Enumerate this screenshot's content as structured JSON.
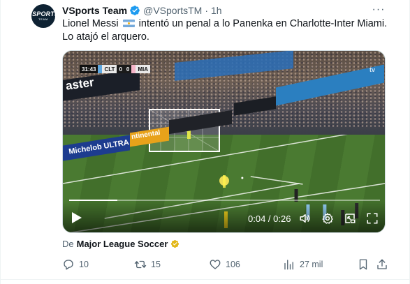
{
  "tweet": {
    "author_name": "VSports Team",
    "handle": "@VSportsTM",
    "separator": "·",
    "time": "1h",
    "avatar_text": "VSPORTS",
    "avatar_subtext": "TEAM",
    "text_part1": "Lionel Messi",
    "text_part2": "intentó un penal a lo Panenka en Charlotte-Inter Miami. Lo atajó el arquero.",
    "more_label": "···"
  },
  "video": {
    "scoreboard": {
      "clock": "31:43",
      "home": "CLT",
      "home_score": "0",
      "away_score": "0",
      "away": "MIA"
    },
    "board_text": "aster",
    "ad_left": "Michelob ULTRA",
    "ad_mid": "ntinental",
    "watermark": "tv",
    "timecode": "0:04 / 0:26",
    "progress_fraction": 0.154
  },
  "attribution": {
    "prefix": "De",
    "source": "Major League Soccer"
  },
  "actions": {
    "replies": "10",
    "reposts": "15",
    "likes": "106",
    "views": "27 mil"
  },
  "colors": {
    "text_primary": "#0f1419",
    "text_secondary": "#536471",
    "verified_blue": "#1d9bf0",
    "verified_gold": "#e2b719",
    "border": "#cfd9de"
  }
}
